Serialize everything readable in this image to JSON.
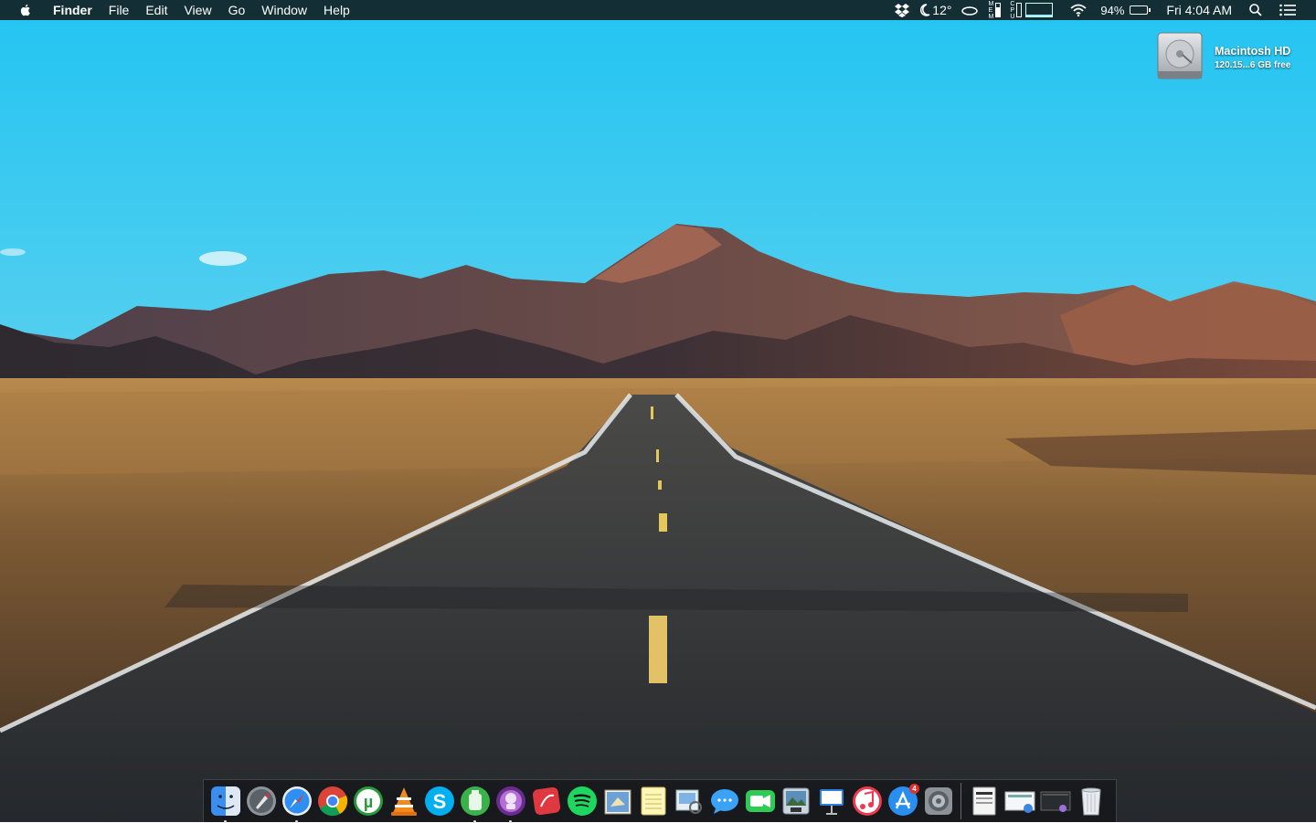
{
  "menubar": {
    "app_name": "Finder",
    "menus": [
      "File",
      "Edit",
      "View",
      "Go",
      "Window",
      "Help"
    ],
    "weather_temp": "12°",
    "battery_percent": "94%",
    "battery_level": 0.94,
    "clock": "Fri 4:04 AM",
    "stat_labels_a": [
      "M",
      "E",
      "M"
    ],
    "stat_labels_b": [
      "C",
      "P",
      "U"
    ]
  },
  "desktop": {
    "drive_name": "Macintosh HD",
    "drive_free": "120.15...6 GB free"
  },
  "dock": {
    "apps": [
      {
        "name": "finder-icon",
        "running": true
      },
      {
        "name": "launchpad-icon",
        "running": false
      },
      {
        "name": "safari-icon",
        "running": true
      },
      {
        "name": "chrome-icon",
        "running": false
      },
      {
        "name": "utorrent-icon",
        "running": false
      },
      {
        "name": "vlc-icon",
        "running": false
      },
      {
        "name": "skype-icon",
        "running": false
      },
      {
        "name": "cleaner-icon",
        "running": true
      },
      {
        "name": "alfred-icon",
        "running": true
      },
      {
        "name": "red-app-icon",
        "running": false
      },
      {
        "name": "spotify-icon",
        "running": false
      },
      {
        "name": "mail-icon",
        "running": false
      },
      {
        "name": "notes-icon",
        "running": false
      },
      {
        "name": "preview-icon",
        "running": false
      },
      {
        "name": "messages-icon",
        "running": false
      },
      {
        "name": "facetime-icon",
        "running": false
      },
      {
        "name": "photo-booth-icon",
        "running": false
      },
      {
        "name": "keynote-icon",
        "running": false
      },
      {
        "name": "itunes-icon",
        "running": false
      },
      {
        "name": "app-store-icon",
        "running": false,
        "badge": "4"
      },
      {
        "name": "system-preferences-icon",
        "running": false
      }
    ],
    "right_items": [
      "document-stack-icon",
      "downloads-stack-icon",
      "screenshot-stack-icon",
      "trash-icon"
    ]
  },
  "colors": {
    "sky_top": "#2ec5f0",
    "sky_horizon": "#9fe0f0",
    "road": "#2e3236",
    "desert": "#8a6a3e"
  }
}
